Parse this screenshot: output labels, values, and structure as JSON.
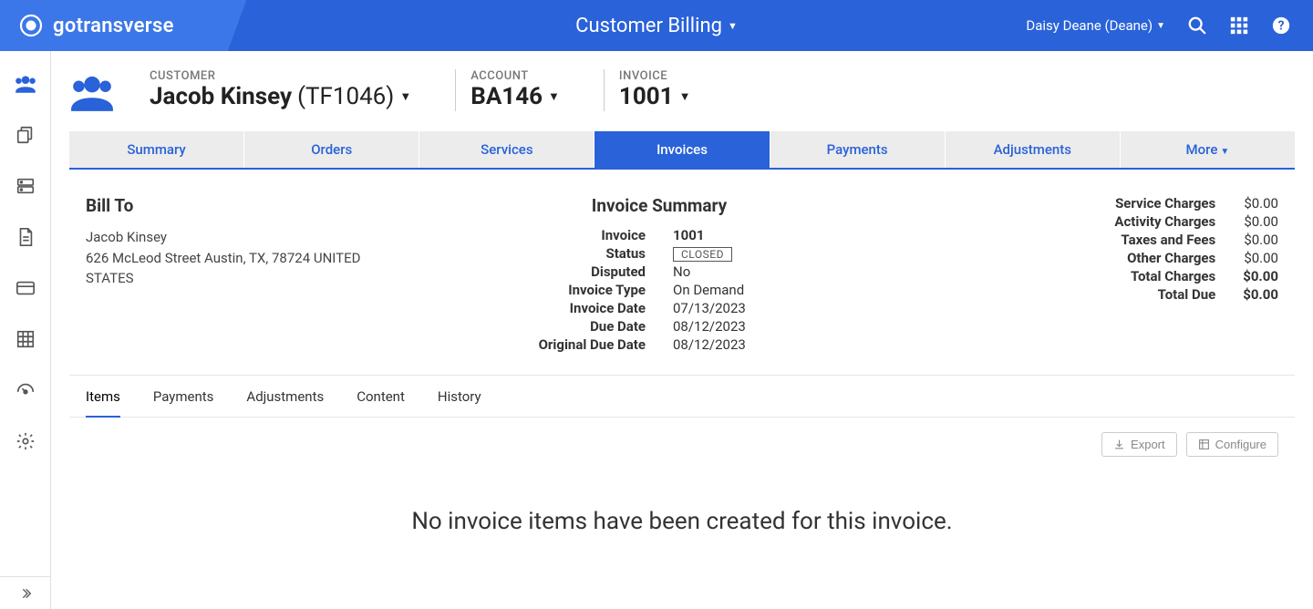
{
  "brand": "gotransverse",
  "page_title": "Customer Billing",
  "user": {
    "display": "Daisy Deane (Deane)"
  },
  "sidebar": {
    "items": [
      "customers",
      "copy",
      "stack",
      "document",
      "card",
      "grid",
      "gauge",
      "gear"
    ]
  },
  "header": {
    "customer_label": "CUSTOMER",
    "customer_name": "Jacob Kinsey",
    "customer_code": "(TF1046)",
    "account_label": "ACCOUNT",
    "account_value": "BA146",
    "invoice_label": "INVOICE",
    "invoice_value": "1001"
  },
  "tabs": {
    "summary": "Summary",
    "orders": "Orders",
    "services": "Services",
    "invoices": "Invoices",
    "payments": "Payments",
    "adjustments": "Adjustments",
    "more": "More"
  },
  "bill_to": {
    "title": "Bill To",
    "name": "Jacob Kinsey",
    "address": "626 McLeod Street Austin, TX, 78724 UNITED STATES"
  },
  "summary": {
    "title": "Invoice Summary",
    "invoice_k": "Invoice",
    "invoice_v": "1001",
    "status_k": "Status",
    "status_v": "CLOSED",
    "disputed_k": "Disputed",
    "disputed_v": "No",
    "type_k": "Invoice Type",
    "type_v": "On Demand",
    "date_k": "Invoice Date",
    "date_v": "07/13/2023",
    "due_k": "Due Date",
    "due_v": "08/12/2023",
    "orig_k": "Original Due Date",
    "orig_v": "08/12/2023"
  },
  "charges": {
    "service_k": "Service Charges",
    "service_v": "$0.00",
    "activity_k": "Activity Charges",
    "activity_v": "$0.00",
    "taxes_k": "Taxes and Fees",
    "taxes_v": "$0.00",
    "other_k": "Other Charges",
    "other_v": "$0.00",
    "total_k": "Total Charges",
    "total_v": "$0.00",
    "due_k": "Total Due",
    "due_v": "$0.00"
  },
  "sub_tabs": {
    "items": "Items",
    "payments": "Payments",
    "adjustments": "Adjustments",
    "content": "Content",
    "history": "History"
  },
  "toolbar": {
    "export": "Export",
    "configure": "Configure"
  },
  "empty": "No invoice items have been created for this invoice."
}
